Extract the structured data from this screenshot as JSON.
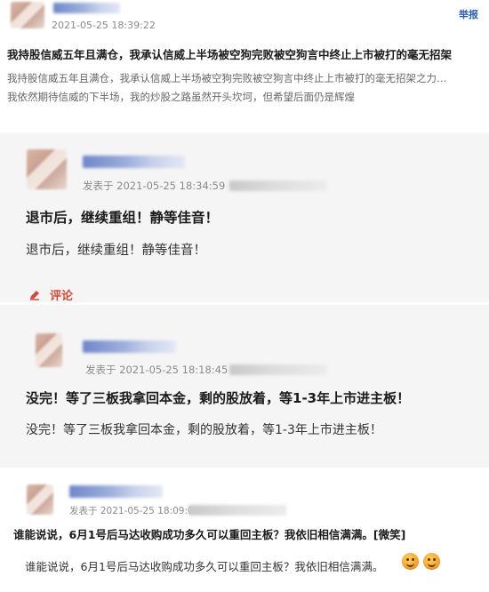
{
  "post": {
    "time": "2021-05-25 18:39:22",
    "report_label": "举报",
    "title": "我持股信威五年且满仓，我承认信威上半场被空狗完败被空狗言中终止上市被打的毫无招架",
    "body_lines": [
      "我持股信威五年且满仓，我承认信威上半场被空狗完败被空狗言中终止上市被打的毫无招架之力…",
      "我依然期待信威的下半场，我的炒股之路虽然开头坎坷，但希望后面仍是辉煌"
    ]
  },
  "replies": [
    {
      "time_prefix": "发表于",
      "time": "2021-05-25 18:34:59",
      "headline": "退市后，继续重组！静等佳音！",
      "body": "退市后，继续重组！静等佳音！",
      "comment_label": "评论"
    },
    {
      "time_prefix": "发表于",
      "time": "2021-05-25 18:18:45",
      "headline": "没完！等了三板我拿回本金，剩的股放着，等1-3年上市进主板！",
      "body": "没完！等了三板我拿回本金，剩的股放着，等1-3年上市进主板！"
    },
    {
      "time_prefix": "发表于",
      "time": "2021-05-25 18:09:00",
      "headline": "谁能说说，6月1号后马达收购成功多久可以重回主板？我依旧相信满满。[微笑]",
      "body": "谁能说说，6月1号后马达收购成功多久可以重回主板？我依旧相信满满。"
    }
  ],
  "icons": {
    "pencil": "pencil-icon",
    "emoji": "smile-emoji-icon"
  },
  "colors": {
    "report": "#2b5fb3",
    "comment": "#d34a3c"
  }
}
